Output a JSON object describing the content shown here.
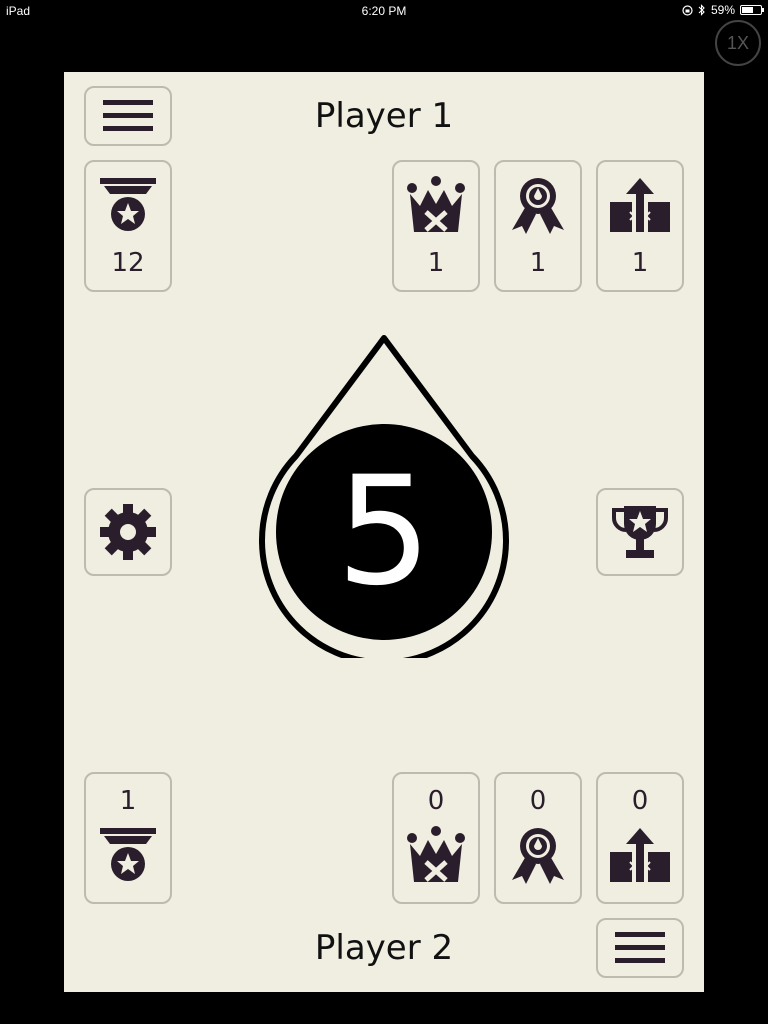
{
  "status_bar": {
    "device": "iPad",
    "time": "6:20 PM",
    "battery": "59%",
    "battery_level": 0.59
  },
  "zoom_badge": "1X",
  "player1": {
    "name": "Player 1",
    "medal_count": "12",
    "crown_count": "1",
    "ribbon_count": "1",
    "arrow_count": "1"
  },
  "player2": {
    "name": "Player 2",
    "medal_count": "1",
    "crown_count": "0",
    "ribbon_count": "0",
    "arrow_count": "0"
  },
  "center": {
    "value": "5"
  },
  "colors": {
    "board": "#f0eee0",
    "icon": "#2a1e2c",
    "border": "#bdbbb0"
  },
  "icons": [
    "menu-icon",
    "medal-star-icon",
    "crown-x-icon",
    "ribbon-drop-icon",
    "arrow-up-icon",
    "gear-icon",
    "trophy-star-icon"
  ]
}
